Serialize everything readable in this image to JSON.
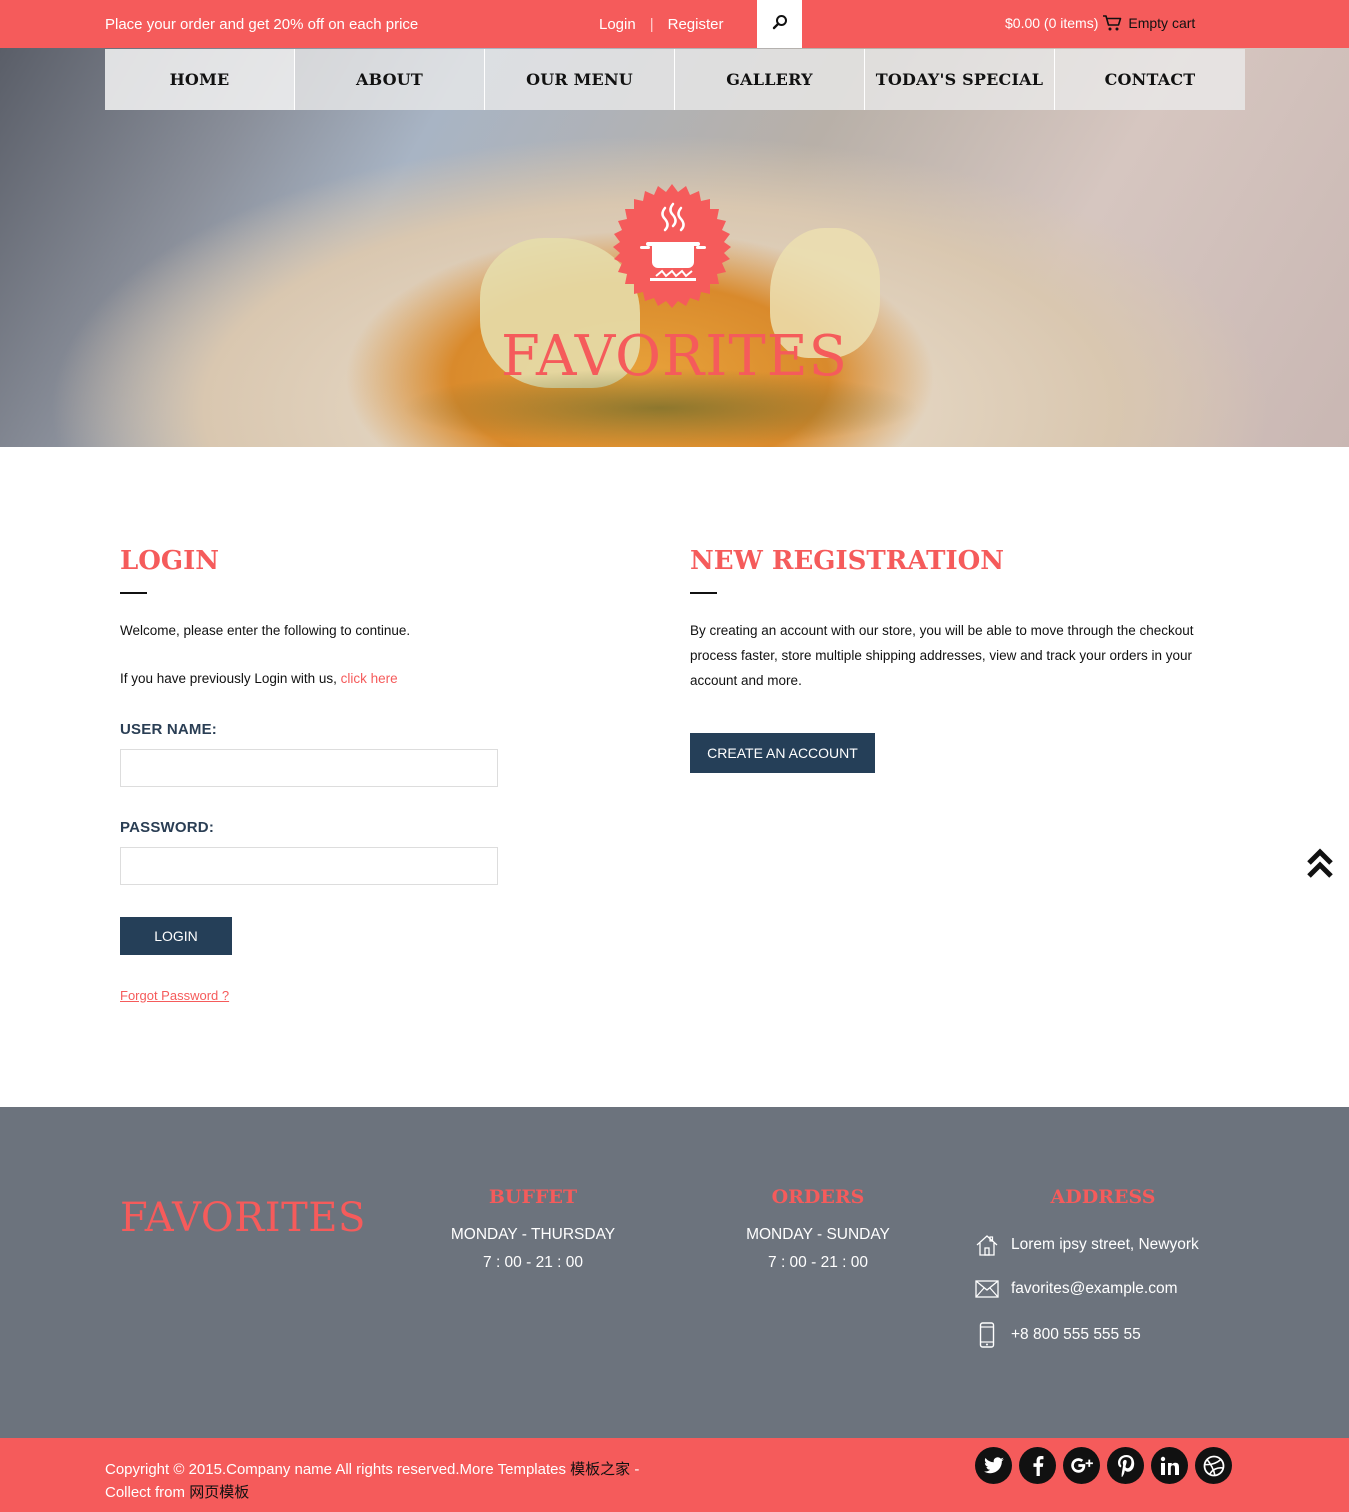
{
  "topbar": {
    "promo": "Place your order and get 20% off on each price",
    "login": "Login",
    "separator": "|",
    "register": "Register",
    "search_icon": "search-icon",
    "cart_total": "$0.00 (0 items)",
    "cart_icon": "cart-icon",
    "cart_empty": "Empty cart"
  },
  "nav": {
    "items": [
      {
        "label": "HOME"
      },
      {
        "label": "ABOUT"
      },
      {
        "label": "OUR MENU"
      },
      {
        "label": "GALLERY"
      },
      {
        "label": "TODAY'S SPECIAL"
      },
      {
        "label": "CONTACT"
      }
    ]
  },
  "hero": {
    "logo_icon": "cooking-pot-icon",
    "title": "FAVORITES"
  },
  "login": {
    "heading": "LOGIN",
    "welcome": "Welcome, please enter the following to continue.",
    "previously": "If you have previously Login with us,",
    "click_here": "click here",
    "username_label": "USER NAME:",
    "username_value": "",
    "password_label": "PASSWORD:",
    "password_value": "",
    "button": "LOGIN",
    "forgot": "Forgot Password ?"
  },
  "register": {
    "heading": "NEW REGISTRATION",
    "description": "By creating an account with our store, you will be able to move through the checkout process faster, store multiple shipping addresses, view and track your orders in your account and more.",
    "button": "CREATE AN ACCOUNT"
  },
  "footer": {
    "brand": "FAVORITES",
    "buffet": {
      "heading": "BUFFET",
      "days": "MONDAY - THURSDAY",
      "hours": "7 : 00 - 21 : 00"
    },
    "orders": {
      "heading": "ORDERS",
      "days": "MONDAY - SUNDAY",
      "hours": "7 : 00 - 21 : 00"
    },
    "address": {
      "heading": "ADDRESS",
      "street": "Lorem ipsy street, Newyork",
      "email": "favorites@example.com",
      "phone": "+8 800 555 555 55"
    },
    "copyright_1": "Copyright © 2015.Company name All rights reserved.More Templates",
    "copyright_link_1": "模板之家",
    "copyright_dash": " -",
    "copyright_2": "Collect from",
    "copyright_link_2": "网页模板",
    "socials": [
      "twitter-icon",
      "facebook-icon",
      "google-plus-icon",
      "pinterest-icon",
      "linkedin-icon",
      "dribbble-icon"
    ]
  },
  "colors": {
    "accent": "#f55b5b",
    "dark_button": "#253f58",
    "footer_bg": "#6c737d"
  }
}
